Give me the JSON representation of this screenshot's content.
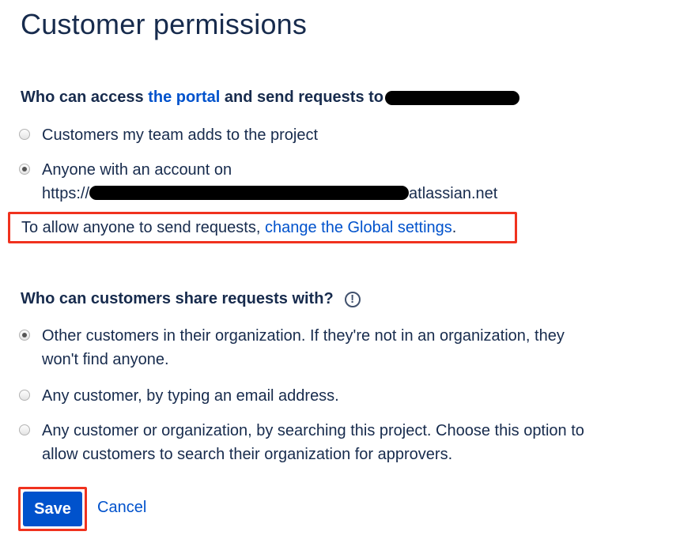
{
  "page": {
    "title": "Customer permissions"
  },
  "access": {
    "heading_prefix": "Who can access ",
    "heading_link": "the portal",
    "heading_suffix": " and send requests to",
    "options": [
      {
        "label": "Customers my team adds to the project",
        "checked": false
      },
      {
        "label_line1": "Anyone with an account on",
        "label_line2_prefix": "https://",
        "label_line2_suffix": "atlassian.net",
        "checked": true
      }
    ],
    "notice_prefix": "To allow anyone to send requests, ",
    "notice_link": "change the Global settings",
    "notice_suffix": "."
  },
  "sharing": {
    "heading": "Who can customers share requests with?",
    "info_icon": "!",
    "options": [
      {
        "line1": "Other customers in their organization. If they're not in an organization, they",
        "line2": "won't find anyone.",
        "checked": true
      },
      {
        "line1": "Any customer, by typing an email address.",
        "checked": false
      },
      {
        "line1": "Any customer or organization, by searching this project. Choose this option to",
        "line2": "allow customers to search their organization for approvers.",
        "checked": false
      }
    ]
  },
  "actions": {
    "save_label": "Save",
    "cancel_label": "Cancel"
  },
  "colors": {
    "text": "#172b4d",
    "link": "#0052cc",
    "primary_button": "#0052cc",
    "highlight_border": "#f0321e"
  }
}
